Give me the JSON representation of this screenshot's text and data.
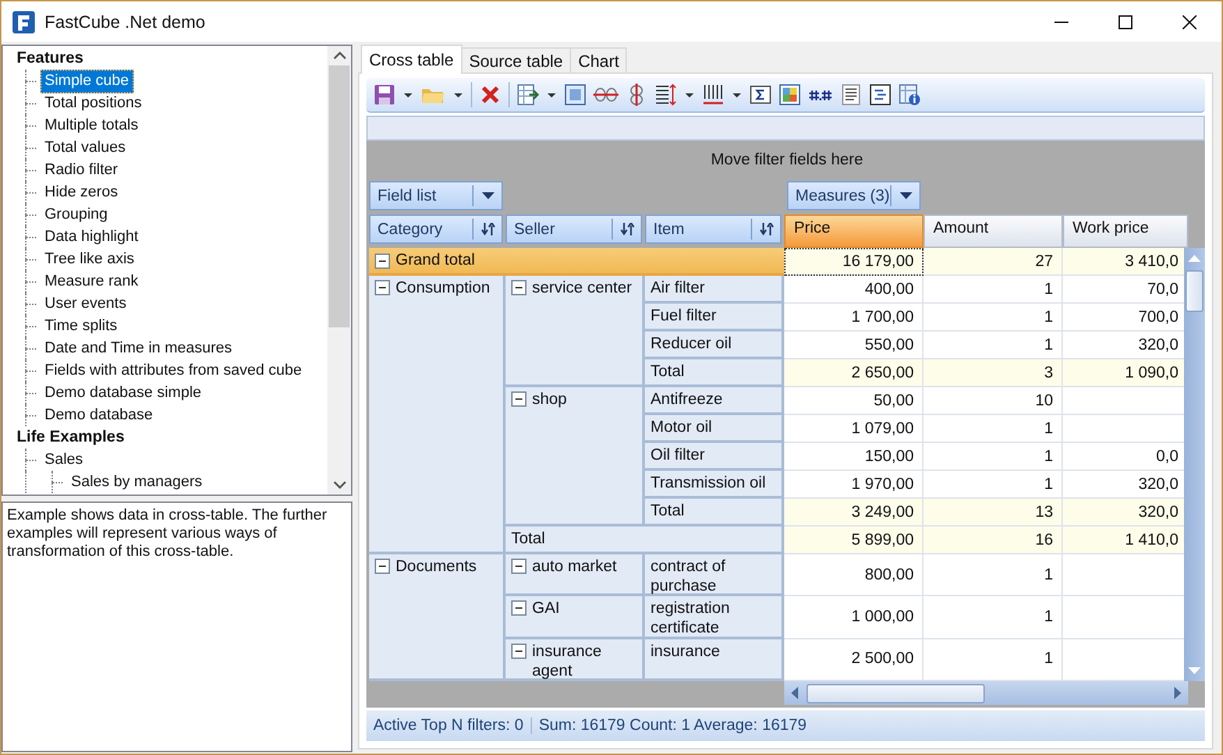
{
  "window": {
    "title": "FastCube .Net demo"
  },
  "tree": [
    {
      "label": "Features",
      "selected": false,
      "children": [
        {
          "label": "Simple cube",
          "selected": true
        },
        {
          "label": "Total positions",
          "selected": false
        },
        {
          "label": "Multiple totals",
          "selected": false
        },
        {
          "label": "Total values",
          "selected": false
        },
        {
          "label": "Radio filter",
          "selected": false
        },
        {
          "label": "Hide zeros",
          "selected": false
        },
        {
          "label": "Grouping",
          "selected": false
        },
        {
          "label": "Data highlight",
          "selected": false
        },
        {
          "label": "Tree like axis",
          "selected": false
        },
        {
          "label": "Measure rank",
          "selected": false
        },
        {
          "label": "User events",
          "selected": false
        },
        {
          "label": "Time splits",
          "selected": false
        },
        {
          "label": "Date and Time in measures",
          "selected": false
        },
        {
          "label": "Fields with attributes from saved cube",
          "selected": false
        },
        {
          "label": "Demo database simple",
          "selected": false
        },
        {
          "label": "Demo database",
          "selected": false
        }
      ]
    },
    {
      "label": "Life Examples",
      "selected": false,
      "children": [
        {
          "label": "Sales",
          "selected": false,
          "children": [
            {
              "label": "Sales by managers",
              "selected": false
            }
          ]
        }
      ]
    }
  ],
  "description": "Example shows data in cross-table. The further examples will represent various ways of transformation of this cross-table.",
  "tabs": [
    {
      "label": "Cross table",
      "selected": true
    },
    {
      "label": "Source table",
      "selected": false
    },
    {
      "label": "Chart",
      "selected": false
    }
  ],
  "pivot": {
    "filter_hint": "Move filter fields here",
    "field_list": "Field list",
    "measures_button": "Measures (3)",
    "row_fields": [
      "Category",
      "Seller",
      "Item"
    ],
    "measures": [
      {
        "label": "Price",
        "selected": true
      },
      {
        "label": "Amount",
        "selected": false
      },
      {
        "label": "Work price",
        "selected": false
      }
    ],
    "grand_total": {
      "label": "Grand total",
      "expanded": true,
      "values": [
        "16 179,00",
        "27",
        "3 410,0"
      ]
    },
    "categories": [
      {
        "label": "Consumption",
        "expanded": true,
        "sellers": [
          {
            "label": "service center",
            "expanded": true,
            "items": [
              {
                "label": "Air filter",
                "values": [
                  "400,00",
                  "1",
                  "70,0"
                ]
              },
              {
                "label": "Fuel filter",
                "values": [
                  "1 700,00",
                  "1",
                  "700,0"
                ]
              },
              {
                "label": "Reducer oil",
                "values": [
                  "550,00",
                  "1",
                  "320,0"
                ]
              }
            ],
            "total": {
              "label": "Total",
              "values": [
                "2 650,00",
                "3",
                "1 090,0"
              ]
            }
          },
          {
            "label": "shop",
            "expanded": true,
            "items": [
              {
                "label": "Antifreeze",
                "values": [
                  "50,00",
                  "10"
                ]
              },
              {
                "label": "Motor oil",
                "values": [
                  "1 079,00",
                  "1"
                ]
              },
              {
                "label": "Oil filter",
                "values": [
                  "150,00",
                  "1",
                  "0,0"
                ]
              },
              {
                "label": "Transmission oil",
                "values": [
                  "1 970,00",
                  "1",
                  "320,0"
                ]
              }
            ],
            "total": {
              "label": "Total",
              "values": [
                "3 249,00",
                "13",
                "320,0"
              ]
            }
          }
        ],
        "total": {
          "label": "Total",
          "values": [
            "5 899,00",
            "16",
            "1 410,0"
          ]
        }
      },
      {
        "label": "Documents",
        "expanded": true,
        "sellers": [
          {
            "label": "auto market",
            "expanded": true,
            "items": [
              {
                "label": "contract of purchase",
                "values": [
                  "800,00",
                  "1"
                ]
              }
            ]
          },
          {
            "label": "GAI",
            "expanded": true,
            "items": [
              {
                "label": "registration certificate",
                "values": [
                  "1 000,00",
                  "1"
                ]
              }
            ]
          },
          {
            "label": "insurance agent",
            "expanded": true,
            "items": [
              {
                "label": "insurance",
                "values": [
                  "2 500,00",
                  "1"
                ]
              }
            ]
          }
        ]
      }
    ]
  },
  "status_bar": [
    "Active Top N filters: 0",
    "Sum: 16179 Count: 1 Average: 16179"
  ]
}
